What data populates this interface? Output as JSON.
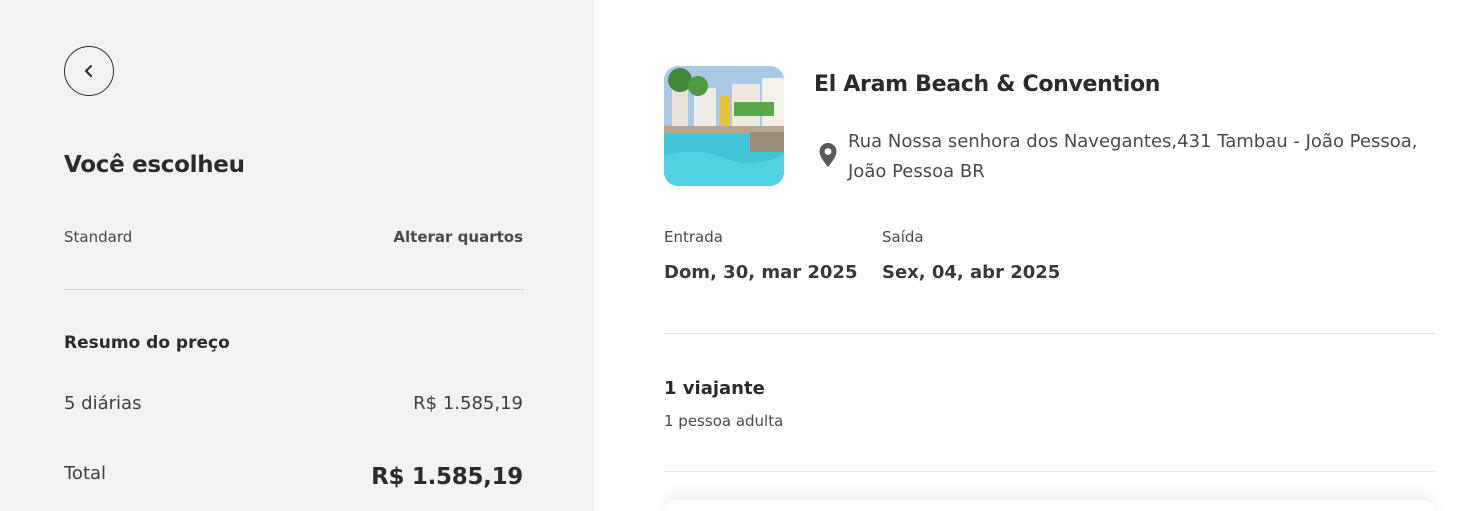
{
  "summary": {
    "heading": "Você escolheu",
    "room_type": "Standard",
    "change_rooms_label": "Alterar quartos",
    "price_title": "Resumo do preço",
    "nights_label": "5 diárias",
    "nights_value": "R$ 1.585,19",
    "total_label": "Total",
    "total_value": "R$ 1.585,19"
  },
  "hotel": {
    "name": "El Aram Beach & Convention",
    "address_line1": "Rua Nossa senhora dos Navegantes,431 Tambau - João Pessoa,",
    "address_line2": "João Pessoa BR"
  },
  "stay": {
    "checkin_label": "Entrada",
    "checkin_value": "Dom, 30, mar 2025",
    "checkout_label": "Saída",
    "checkout_value": "Sex, 04, abr 2025"
  },
  "guests": {
    "travelers": "1 viajante",
    "adults": "1 pessoa adulta"
  },
  "icons": {
    "back": "chevron-left-icon",
    "location": "map-pin-icon"
  },
  "colors": {
    "left_panel_bg": "#f2f2f2",
    "text_primary": "#2b2b2b",
    "back_border": "#3a2a22"
  }
}
